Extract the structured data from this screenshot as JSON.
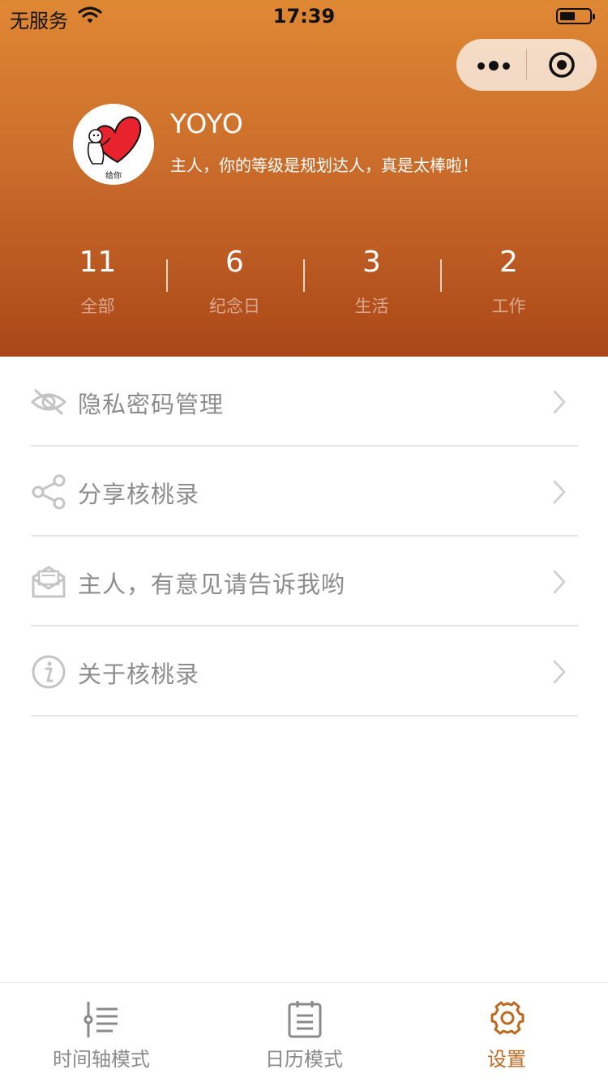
{
  "status_bar": {
    "carrier": "无服务",
    "time": "17:39"
  },
  "profile": {
    "username": "YOYO",
    "motto": "主人，你的等级是规划达人，真是太棒啦！",
    "avatar_caption": "给你"
  },
  "stats": [
    {
      "value": "11",
      "label": "全部"
    },
    {
      "value": "6",
      "label": "纪念日"
    },
    {
      "value": "3",
      "label": "生活"
    },
    {
      "value": "2",
      "label": "工作"
    }
  ],
  "menu": {
    "items": [
      {
        "label": "隐私密码管理",
        "icon": "eye-hidden-icon"
      },
      {
        "label": "分享核桃录",
        "icon": "share-icon"
      },
      {
        "label": "主人，有意见请告诉我哟",
        "icon": "mail-icon"
      },
      {
        "label": "关于核桃录",
        "icon": "info-icon"
      }
    ]
  },
  "tabbar": {
    "tabs": [
      {
        "label": "时间轴模式",
        "icon": "timeline-icon",
        "active": false
      },
      {
        "label": "日历模式",
        "icon": "clipboard-icon",
        "active": false
      },
      {
        "label": "设置",
        "icon": "gear-icon",
        "active": true
      }
    ]
  },
  "colors": {
    "header_top": "#df8834",
    "header_bottom": "#ab4718",
    "accent": "#bd6a1f",
    "menu_text": "#8c8c8c",
    "heart": "#e8232e"
  }
}
